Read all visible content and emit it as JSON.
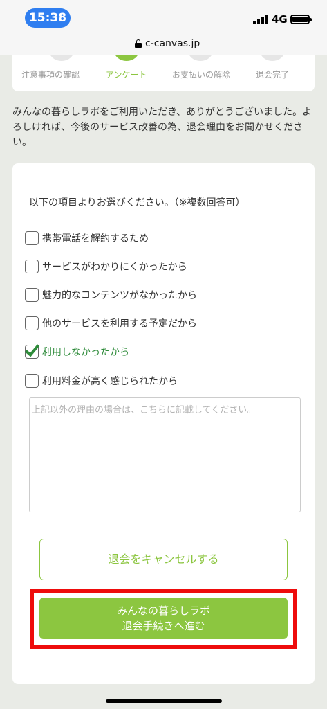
{
  "status_bar": {
    "time": "15:38",
    "network": "4G"
  },
  "browser": {
    "url": "c-canvas.jp"
  },
  "steps": [
    {
      "label": "注意事項の確認",
      "active": false
    },
    {
      "label": "アンケート",
      "active": true
    },
    {
      "label": "お支払いの解除",
      "active": false
    },
    {
      "label": "退会完了",
      "active": false
    }
  ],
  "intro": "みんなの暮らしラボをご利用いただき、ありがとうございました。よろしければ、今後のサービス改善の為、退会理由をお聞かせください。",
  "form": {
    "title": "以下の項目よりお選びください。（※複数回答可）",
    "options": [
      {
        "label": "携帯電話を解約するため",
        "checked": false
      },
      {
        "label": "サービスがわかりにくかったから",
        "checked": false
      },
      {
        "label": "魅力的なコンテンツがなかったから",
        "checked": false
      },
      {
        "label": "他のサービスを利用する予定だから",
        "checked": false
      },
      {
        "label": "利用しなかったから",
        "checked": true
      },
      {
        "label": "利用料金が高く感じられたから",
        "checked": false
      }
    ],
    "textarea_placeholder": "上記以外の理由の場合は、こちらに記載してください。",
    "cancel_label": "退会をキャンセルする",
    "proceed_line1": "みんなの暮らしラボ",
    "proceed_line2": "退会手続きへ進む"
  },
  "colors": {
    "accent": "#8cc640",
    "checked": "#2e8b3a",
    "highlight": "#ee0c0c",
    "time_pill": "#2f7ef0"
  }
}
